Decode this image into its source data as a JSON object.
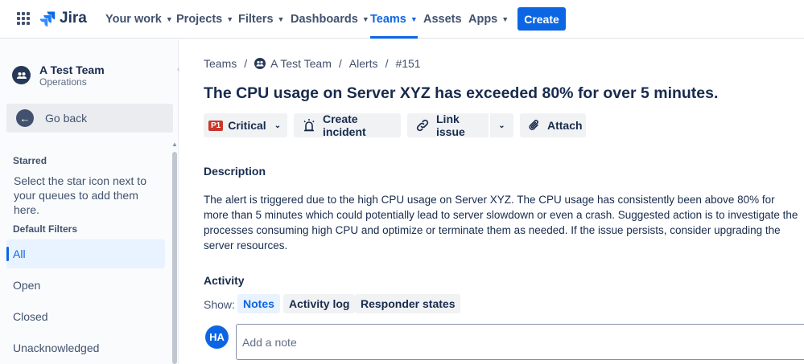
{
  "nav": {
    "logo_text": "Jira",
    "items": [
      {
        "label": "Your work",
        "chevron": true
      },
      {
        "label": "Projects",
        "chevron": true
      },
      {
        "label": "Filters",
        "chevron": true
      },
      {
        "label": "Dashboards",
        "chevron": true
      },
      {
        "label": "Teams",
        "chevron": true,
        "active": true
      },
      {
        "label": "Assets",
        "chevron": false
      },
      {
        "label": "Apps",
        "chevron": true
      }
    ],
    "create_label": "Create"
  },
  "sidebar": {
    "team_name": "A Test Team",
    "team_sub": "Operations",
    "go_back": "Go back",
    "starred_head": "Starred",
    "starred_text": "Select the star icon next to your queues to add them here.",
    "default_filters_head": "Default Filters",
    "filters": [
      {
        "label": "All",
        "selected": true
      },
      {
        "label": "Open"
      },
      {
        "label": "Closed"
      },
      {
        "label": "Unacknowledged"
      }
    ]
  },
  "breadcrumb": {
    "teams": "Teams",
    "team": "A Test Team",
    "alerts": "Alerts",
    "id": "#151",
    "sep": "/"
  },
  "alert": {
    "title": "The CPU usage on Server XYZ has exceeded 80% for over 5 minutes.",
    "priority_badge": "P1",
    "priority_label": "Critical",
    "create_incident": "Create incident",
    "link_issue": "Link issue",
    "attach": "Attach",
    "description_head": "Description",
    "description": "The alert is triggered due to the high CPU usage on Server XYZ. The CPU usage has consistently been above 80% for more than 5 minutes which could potentially lead to server slowdown or even a crash. Suggested action is to investigate the processes consuming high CPU and optimize or terminate them as needed. If the issue persists, consider upgrading the server resources."
  },
  "activity": {
    "head": "Activity",
    "show_label": "Show:",
    "tabs": [
      "Notes",
      "Activity log",
      "Responder states"
    ],
    "active_tab": "Notes",
    "user_initials": "HA",
    "note_placeholder": "Add a note"
  },
  "colors": {
    "brand": "#0c66e4",
    "priority_critical": "#c9372c"
  }
}
